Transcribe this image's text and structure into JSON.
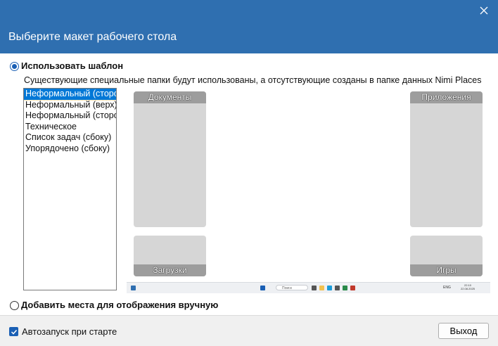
{
  "window": {
    "header_title": "Выберите макет рабочего стола",
    "close_icon": "close-icon"
  },
  "template_option": {
    "label": "Использовать шаблон",
    "selected": true,
    "description": "Существующие специальные папки будут использованы, а отсутствующие созданы в папке данных Nimi Places"
  },
  "layouts": [
    {
      "label": "Неформальный (сторо",
      "selected": true
    },
    {
      "label": "Неформальный (верх)",
      "selected": false
    },
    {
      "label": "Неформальный (сторо",
      "selected": false
    },
    {
      "label": "Техническое",
      "selected": false
    },
    {
      "label": "Список задач (сбоку)",
      "selected": false
    },
    {
      "label": "Упорядочено (сбоку)",
      "selected": false
    }
  ],
  "preview": {
    "documents": "Документы",
    "apps": "Приложения",
    "downloads": "Загрузки",
    "games": "Игры",
    "taskbar_search": "Поиск",
    "taskbar_lang": "ENG",
    "taskbar_time": "22:10",
    "taskbar_date": "22.08.2025"
  },
  "manual_option": {
    "label": "Добавить места для отображения вручную",
    "selected": false
  },
  "footer": {
    "autostart_label": "Автозапуск при старте",
    "autostart_checked": true,
    "exit_label": "Выход"
  },
  "colors": {
    "accent": "#2f6fb0",
    "selection": "#0078d7",
    "folder_bg": "#d6d6d6",
    "folder_label_bg": "#9d9d9d"
  }
}
